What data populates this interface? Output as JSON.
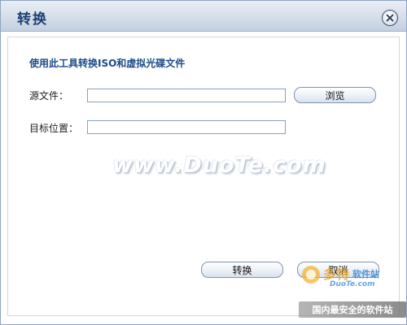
{
  "window": {
    "title": "转换"
  },
  "form": {
    "heading": "使用此工具转换ISO和虚拟光碟文件",
    "source_label": "源文件：",
    "source_value": "",
    "browse_label": "浏览",
    "target_label": "目标位置：",
    "target_value": ""
  },
  "actions": {
    "convert_label": "转换",
    "cancel_label": "取消"
  },
  "watermark": {
    "main_text": "www.DuoTe.com",
    "logo_text": "多特",
    "logo_sub": "软件站",
    "logo_domain": "DuoTe.com",
    "footer_text": "国内最安全的软件站"
  },
  "icons": {
    "close": "close-icon"
  },
  "colors": {
    "title": "#1a3f74",
    "heading": "#1d4b86"
  }
}
